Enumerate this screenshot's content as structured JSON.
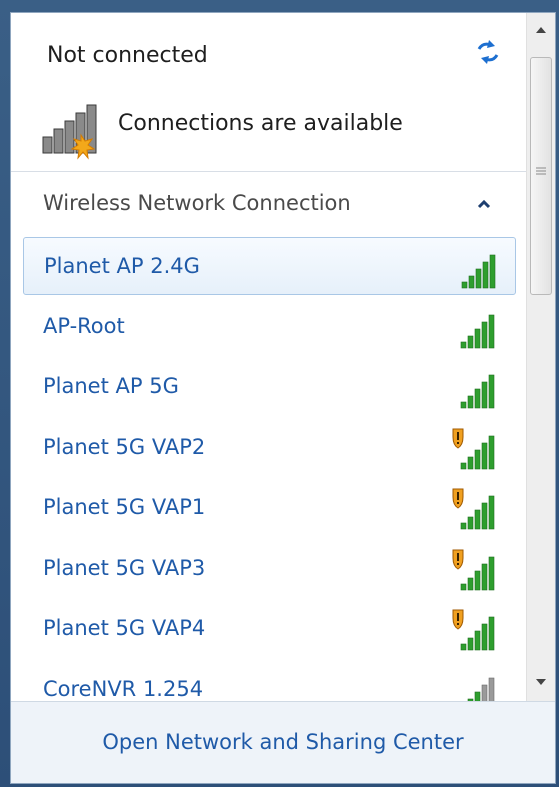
{
  "header": {
    "status": "Not connected",
    "connections_text": "Connections are available"
  },
  "section": {
    "title": "Wireless Network Connection"
  },
  "networks": [
    {
      "name": "Planet AP 2.4G",
      "secured": false,
      "strength": 5,
      "selected": true
    },
    {
      "name": "AP-Root",
      "secured": false,
      "strength": 5,
      "selected": false
    },
    {
      "name": "Planet AP 5G",
      "secured": false,
      "strength": 5,
      "selected": false
    },
    {
      "name": "Planet 5G VAP2",
      "secured": true,
      "strength": 5,
      "selected": false
    },
    {
      "name": "Planet 5G VAP1",
      "secured": true,
      "strength": 5,
      "selected": false
    },
    {
      "name": "Planet 5G VAP3",
      "secured": true,
      "strength": 5,
      "selected": false
    },
    {
      "name": "Planet 5G VAP4",
      "secured": true,
      "strength": 5,
      "selected": false
    },
    {
      "name": "CoreNVR 1.254",
      "secured": false,
      "strength": 3,
      "selected": false
    }
  ],
  "footer": {
    "link": "Open Network and Sharing Center"
  },
  "colors": {
    "link": "#1f5aa8",
    "signal_green": "#2e9e2e",
    "signal_gray": "#9a9a9a",
    "shield_orange": "#f0a020"
  }
}
